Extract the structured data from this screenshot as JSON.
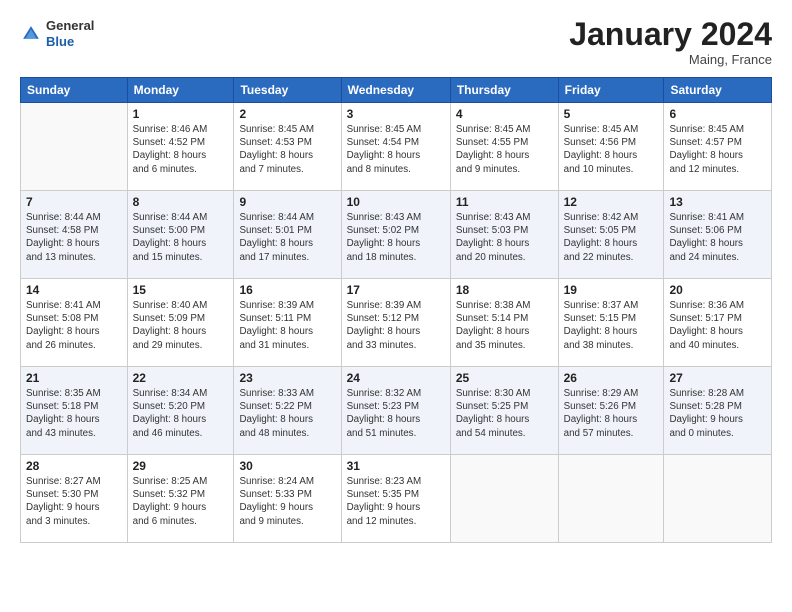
{
  "header": {
    "logo_general": "General",
    "logo_blue": "Blue",
    "month_title": "January 2024",
    "location": "Maing, France"
  },
  "days_of_week": [
    "Sunday",
    "Monday",
    "Tuesday",
    "Wednesday",
    "Thursday",
    "Friday",
    "Saturday"
  ],
  "weeks": [
    {
      "days": [
        {
          "num": "",
          "empty": true
        },
        {
          "num": "1",
          "sunrise": "Sunrise: 8:46 AM",
          "sunset": "Sunset: 4:52 PM",
          "daylight": "Daylight: 8 hours and 6 minutes."
        },
        {
          "num": "2",
          "sunrise": "Sunrise: 8:45 AM",
          "sunset": "Sunset: 4:53 PM",
          "daylight": "Daylight: 8 hours and 7 minutes."
        },
        {
          "num": "3",
          "sunrise": "Sunrise: 8:45 AM",
          "sunset": "Sunset: 4:54 PM",
          "daylight": "Daylight: 8 hours and 8 minutes."
        },
        {
          "num": "4",
          "sunrise": "Sunrise: 8:45 AM",
          "sunset": "Sunset: 4:55 PM",
          "daylight": "Daylight: 8 hours and 9 minutes."
        },
        {
          "num": "5",
          "sunrise": "Sunrise: 8:45 AM",
          "sunset": "Sunset: 4:56 PM",
          "daylight": "Daylight: 8 hours and 10 minutes."
        },
        {
          "num": "6",
          "sunrise": "Sunrise: 8:45 AM",
          "sunset": "Sunset: 4:57 PM",
          "daylight": "Daylight: 8 hours and 12 minutes."
        }
      ]
    },
    {
      "days": [
        {
          "num": "7",
          "sunrise": "Sunrise: 8:44 AM",
          "sunset": "Sunset: 4:58 PM",
          "daylight": "Daylight: 8 hours and 13 minutes."
        },
        {
          "num": "8",
          "sunrise": "Sunrise: 8:44 AM",
          "sunset": "Sunset: 5:00 PM",
          "daylight": "Daylight: 8 hours and 15 minutes."
        },
        {
          "num": "9",
          "sunrise": "Sunrise: 8:44 AM",
          "sunset": "Sunset: 5:01 PM",
          "daylight": "Daylight: 8 hours and 17 minutes."
        },
        {
          "num": "10",
          "sunrise": "Sunrise: 8:43 AM",
          "sunset": "Sunset: 5:02 PM",
          "daylight": "Daylight: 8 hours and 18 minutes."
        },
        {
          "num": "11",
          "sunrise": "Sunrise: 8:43 AM",
          "sunset": "Sunset: 5:03 PM",
          "daylight": "Daylight: 8 hours and 20 minutes."
        },
        {
          "num": "12",
          "sunrise": "Sunrise: 8:42 AM",
          "sunset": "Sunset: 5:05 PM",
          "daylight": "Daylight: 8 hours and 22 minutes."
        },
        {
          "num": "13",
          "sunrise": "Sunrise: 8:41 AM",
          "sunset": "Sunset: 5:06 PM",
          "daylight": "Daylight: 8 hours and 24 minutes."
        }
      ]
    },
    {
      "days": [
        {
          "num": "14",
          "sunrise": "Sunrise: 8:41 AM",
          "sunset": "Sunset: 5:08 PM",
          "daylight": "Daylight: 8 hours and 26 minutes."
        },
        {
          "num": "15",
          "sunrise": "Sunrise: 8:40 AM",
          "sunset": "Sunset: 5:09 PM",
          "daylight": "Daylight: 8 hours and 29 minutes."
        },
        {
          "num": "16",
          "sunrise": "Sunrise: 8:39 AM",
          "sunset": "Sunset: 5:11 PM",
          "daylight": "Daylight: 8 hours and 31 minutes."
        },
        {
          "num": "17",
          "sunrise": "Sunrise: 8:39 AM",
          "sunset": "Sunset: 5:12 PM",
          "daylight": "Daylight: 8 hours and 33 minutes."
        },
        {
          "num": "18",
          "sunrise": "Sunrise: 8:38 AM",
          "sunset": "Sunset: 5:14 PM",
          "daylight": "Daylight: 8 hours and 35 minutes."
        },
        {
          "num": "19",
          "sunrise": "Sunrise: 8:37 AM",
          "sunset": "Sunset: 5:15 PM",
          "daylight": "Daylight: 8 hours and 38 minutes."
        },
        {
          "num": "20",
          "sunrise": "Sunrise: 8:36 AM",
          "sunset": "Sunset: 5:17 PM",
          "daylight": "Daylight: 8 hours and 40 minutes."
        }
      ]
    },
    {
      "days": [
        {
          "num": "21",
          "sunrise": "Sunrise: 8:35 AM",
          "sunset": "Sunset: 5:18 PM",
          "daylight": "Daylight: 8 hours and 43 minutes."
        },
        {
          "num": "22",
          "sunrise": "Sunrise: 8:34 AM",
          "sunset": "Sunset: 5:20 PM",
          "daylight": "Daylight: 8 hours and 46 minutes."
        },
        {
          "num": "23",
          "sunrise": "Sunrise: 8:33 AM",
          "sunset": "Sunset: 5:22 PM",
          "daylight": "Daylight: 8 hours and 48 minutes."
        },
        {
          "num": "24",
          "sunrise": "Sunrise: 8:32 AM",
          "sunset": "Sunset: 5:23 PM",
          "daylight": "Daylight: 8 hours and 51 minutes."
        },
        {
          "num": "25",
          "sunrise": "Sunrise: 8:30 AM",
          "sunset": "Sunset: 5:25 PM",
          "daylight": "Daylight: 8 hours and 54 minutes."
        },
        {
          "num": "26",
          "sunrise": "Sunrise: 8:29 AM",
          "sunset": "Sunset: 5:26 PM",
          "daylight": "Daylight: 8 hours and 57 minutes."
        },
        {
          "num": "27",
          "sunrise": "Sunrise: 8:28 AM",
          "sunset": "Sunset: 5:28 PM",
          "daylight": "Daylight: 9 hours and 0 minutes."
        }
      ]
    },
    {
      "days": [
        {
          "num": "28",
          "sunrise": "Sunrise: 8:27 AM",
          "sunset": "Sunset: 5:30 PM",
          "daylight": "Daylight: 9 hours and 3 minutes."
        },
        {
          "num": "29",
          "sunrise": "Sunrise: 8:25 AM",
          "sunset": "Sunset: 5:32 PM",
          "daylight": "Daylight: 9 hours and 6 minutes."
        },
        {
          "num": "30",
          "sunrise": "Sunrise: 8:24 AM",
          "sunset": "Sunset: 5:33 PM",
          "daylight": "Daylight: 9 hours and 9 minutes."
        },
        {
          "num": "31",
          "sunrise": "Sunrise: 8:23 AM",
          "sunset": "Sunset: 5:35 PM",
          "daylight": "Daylight: 9 hours and 12 minutes."
        },
        {
          "num": "",
          "empty": true
        },
        {
          "num": "",
          "empty": true
        },
        {
          "num": "",
          "empty": true
        }
      ]
    }
  ]
}
